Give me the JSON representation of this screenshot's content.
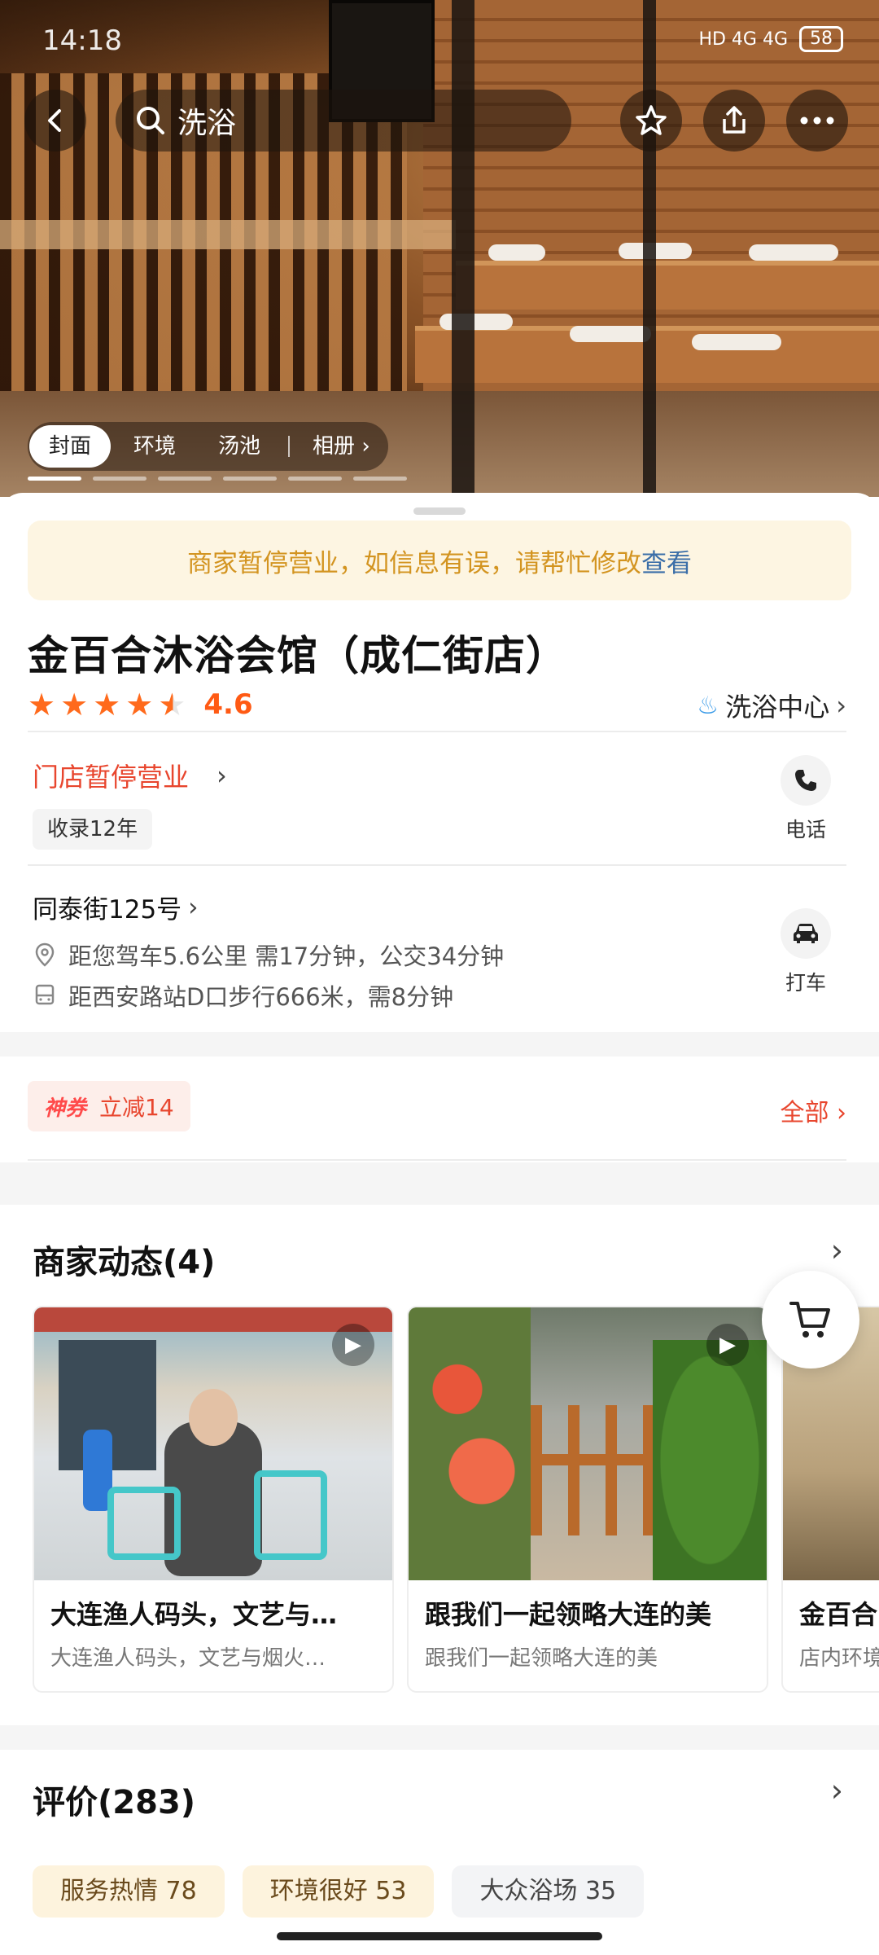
{
  "status_bar": {
    "time": "14:18",
    "network": "HD 4G 4G",
    "battery": "58"
  },
  "header": {
    "search_text": "洗浴"
  },
  "gallery": {
    "tabs": [
      "封面",
      "环境",
      "汤池"
    ],
    "album_label": "相册",
    "indicator_count": 6,
    "active_index": 0
  },
  "notice": {
    "text": "商家暂停营业，如信息有误，请帮忙修改",
    "link": "查看"
  },
  "shop": {
    "name": "金百合沐浴会馆（成仁街店）",
    "rating": "4.6",
    "rating_value": 4.6,
    "category": "洗浴中心",
    "status": "门店暂停营业",
    "tenure": "收录12年",
    "phone_label": "电话",
    "taxi_label": "打车",
    "address": "同泰街125号",
    "drive_info": "距您驾车5.6公里 需17分钟，公交34分钟",
    "transit_info": "距西安路站D口步行666米，需8分钟"
  },
  "coupon": {
    "badge": "神券",
    "text": "立减14",
    "all_label": "全部"
  },
  "updates": {
    "title": "商家动态(4)",
    "cards": [
      {
        "title": "大连渔人码头，文艺与…",
        "subtitle": "大连渔人码头，文艺与烟火…"
      },
      {
        "title": "跟我们一起领略大连的美",
        "subtitle": "跟我们一起领略大连的美"
      },
      {
        "title": "金百合",
        "subtitle": "店内环境"
      }
    ]
  },
  "reviews": {
    "title": "评价(283)",
    "tags": [
      "服务热情 78",
      "环境很好 53",
      "大众浴场 35"
    ]
  },
  "colors": {
    "accent": "#ff5a14",
    "closed": "#e8462e",
    "notice_bg": "#fdf5e2",
    "notice_text": "#d39420",
    "link": "#3b6ea8"
  }
}
